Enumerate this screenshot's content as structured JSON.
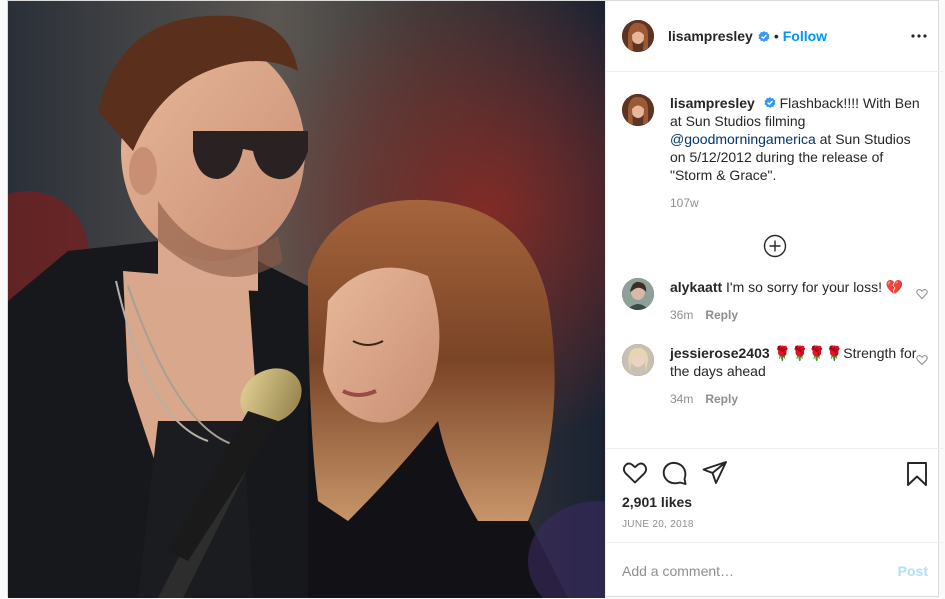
{
  "post": {
    "author": "lisampresley",
    "follow_label": "Follow",
    "dot": "•",
    "more_icon": "more-horizontal-icon"
  },
  "caption": {
    "username": "lisampresley",
    "text_before": "Flashback!!!! With Ben at Sun Studios filming ",
    "mention": "@goodmorningamerica",
    "text_after": " at Sun Studios on 5/12/2012 during the release of \"Storm & Grace\".",
    "time": "107w"
  },
  "load_more_icon": "plus-circle-icon",
  "comments": [
    {
      "username": "alykaatt",
      "text": "I'm so sorry for your loss! 💔",
      "time": "36m",
      "reply_label": "Reply"
    },
    {
      "username": "jessierose2403",
      "text": "🌹🌹🌹🌹Strength for the days ahead",
      "time": "34m",
      "reply_label": "Reply"
    }
  ],
  "actions": {
    "icons": [
      "heart-icon",
      "comment-icon",
      "share-icon",
      "bookmark-icon"
    ],
    "likes": "2,901 likes",
    "date": "JUNE 20, 2018"
  },
  "add_comment": {
    "placeholder": "Add a comment…",
    "post_label": "Post"
  },
  "colors": {
    "link": "#0095f6",
    "mention": "#00376b",
    "muted": "#8e8e8e",
    "post_disabled": "#b2dffc",
    "border": "#dbdbdb"
  }
}
